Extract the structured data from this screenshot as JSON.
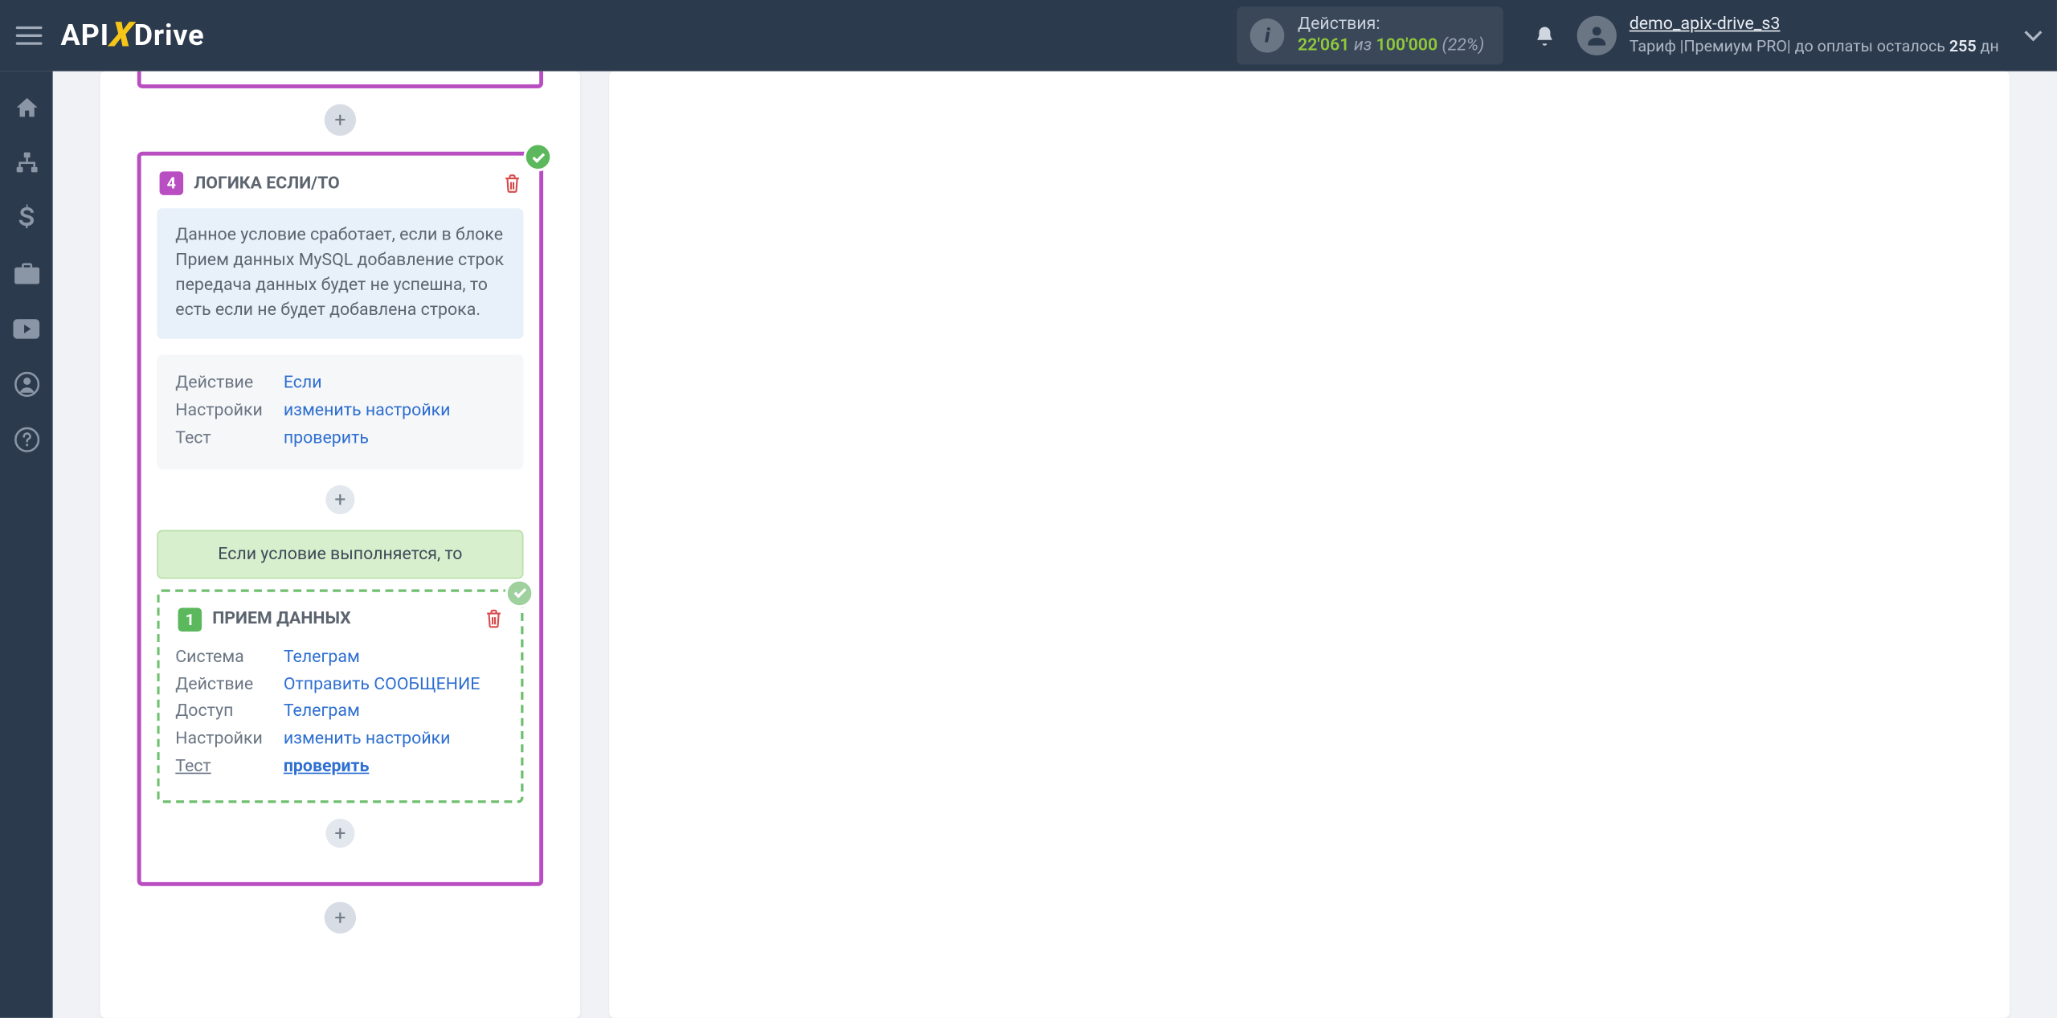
{
  "header": {
    "logo": {
      "p1": "API",
      "p2": "X",
      "p3": "Drive"
    },
    "actions_label": "Действия:",
    "used": "22'061",
    "of": "из",
    "total": "100'000",
    "pct": "(22%)"
  },
  "user": {
    "name": "demo_apix-drive_s3",
    "tariff_prefix": "Тариф |Премиум PRO| до оплаты осталось ",
    "days": "255",
    "tariff_suffix": " дн"
  },
  "logic_card": {
    "num": "4",
    "title": "ЛОГИКА ЕСЛИ/ТО",
    "desc": "Данное условие сработает, если в блоке Прием данных MySQL добавление строк передача данных будет не успешна, то есть если не будет добавлена строка.",
    "rows": {
      "action_label": "Действие",
      "action_val": "Если",
      "settings_label": "Настройки",
      "settings_val": "изменить настройки",
      "test_label": "Тест",
      "test_val": "проверить"
    },
    "cond_banner": "Если условие выполняется, то"
  },
  "nested_card": {
    "num": "1",
    "title": "ПРИЕМ ДАННЫХ",
    "rows": {
      "system_label": "Система",
      "system_val": "Телеграм",
      "action_label": "Действие",
      "action_val": "Отправить СООБЩЕНИЕ",
      "access_label": "Доступ",
      "access_val": "Телеграм",
      "settings_label": "Настройки",
      "settings_val": "изменить настройки",
      "test_label": "Тест",
      "test_val": "проверить"
    }
  },
  "icons": {
    "plus": "+"
  }
}
